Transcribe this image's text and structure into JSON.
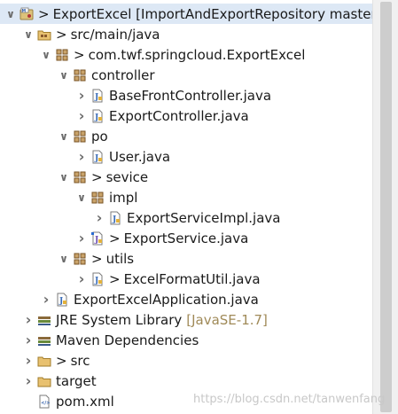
{
  "tree": [
    {
      "label": "ExportExcel [ImportAndExportRepository master]",
      "decor": ">",
      "icon": "maven-project-icon",
      "level": 0,
      "state": "expanded",
      "selected": true
    },
    {
      "label": "src/main/java",
      "decor": ">",
      "icon": "source-folder-icon",
      "level": 1,
      "state": "expanded"
    },
    {
      "label": "com.twf.springcloud.ExportExcel",
      "decor": ">",
      "icon": "package-icon",
      "level": 2,
      "state": "expanded"
    },
    {
      "label": "controller",
      "decor": "",
      "icon": "package-icon",
      "level": 3,
      "state": "expanded"
    },
    {
      "label": "BaseFrontController.java",
      "decor": "",
      "icon": "java-file-icon",
      "level": 4,
      "state": "collapsed"
    },
    {
      "label": "ExportController.java",
      "decor": "",
      "icon": "java-file-icon",
      "level": 4,
      "state": "collapsed"
    },
    {
      "label": "po",
      "decor": "",
      "icon": "package-icon",
      "level": 3,
      "state": "expanded"
    },
    {
      "label": "User.java",
      "decor": "",
      "icon": "java-file-icon",
      "level": 4,
      "state": "collapsed"
    },
    {
      "label": "sevice",
      "decor": ">",
      "icon": "package-icon",
      "level": 3,
      "state": "expanded"
    },
    {
      "label": "impl",
      "decor": "",
      "icon": "package-icon",
      "level": 4,
      "state": "expanded"
    },
    {
      "label": "ExportServiceImpl.java",
      "decor": "",
      "icon": "java-file-icon",
      "level": 5,
      "state": "collapsed"
    },
    {
      "label": "ExportService.java",
      "decor": ">",
      "icon": "java-file-modified-icon",
      "level": 4,
      "state": "collapsed"
    },
    {
      "label": "utils",
      "decor": ">",
      "icon": "package-icon",
      "level": 3,
      "state": "expanded"
    },
    {
      "label": "ExcelFormatUtil.java",
      "decor": ">",
      "icon": "java-file-icon",
      "level": 4,
      "state": "collapsed"
    },
    {
      "label": "ExportExcelApplication.java",
      "decor": "",
      "icon": "java-file-icon",
      "level": 2,
      "state": "collapsed"
    },
    {
      "label": "JRE System Library",
      "decor": "",
      "icon": "library-icon",
      "level": 1,
      "state": "collapsed",
      "suffix": "[JavaSE-1.7]"
    },
    {
      "label": "Maven Dependencies",
      "decor": "",
      "icon": "library-icon",
      "level": 1,
      "state": "collapsed"
    },
    {
      "label": "src",
      "decor": ">",
      "icon": "folder-icon",
      "level": 1,
      "state": "collapsed"
    },
    {
      "label": "target",
      "decor": "",
      "icon": "folder-icon",
      "level": 1,
      "state": "collapsed"
    },
    {
      "label": "pom.xml",
      "decor": "",
      "icon": "xml-file-icon",
      "level": 1,
      "state": "none"
    }
  ],
  "watermark": "https://blog.csdn.net/tanwenfang"
}
